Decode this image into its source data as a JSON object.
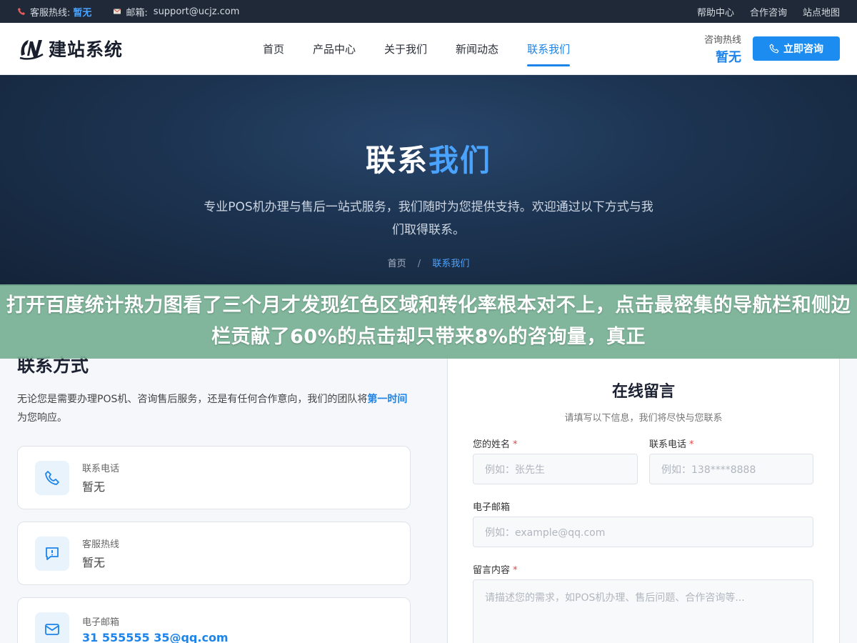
{
  "topbar": {
    "hotline_label": "客服热线:",
    "hotline_value": "暂无",
    "email_label": "邮箱:",
    "email_value": "support@ucjz.com",
    "links": [
      "帮助中心",
      "合作咨询",
      "站点地图"
    ]
  },
  "header": {
    "logo_text": "建站系统",
    "nav": [
      "首页",
      "产品中心",
      "关于我们",
      "新闻动态",
      "联系我们"
    ],
    "active_nav": "联系我们",
    "hotline_label": "咨询热线",
    "hotline_value": "暂无",
    "consult_button": "立即咨询"
  },
  "hero": {
    "title_part1": "联系",
    "title_part2": "我们",
    "subtitle": "专业POS机办理与售后一站式服务，我们随时为您提供支持。欢迎通过以下方式与我们取得联系。",
    "breadcrumb_home": "首页",
    "breadcrumb_sep": "/",
    "breadcrumb_current": "联系我们"
  },
  "banner": {
    "text": "打开百度统计热力图看了三个月才发现红色区域和转化率根本对不上，点击最密集的导航栏和侧边栏贡献了60%的点击却只带来8%的咨询量，真正"
  },
  "contact": {
    "title": "联系方式",
    "desc_prefix": "无论您是需要办理POS机、咨询售后服务，还是有任何合作意向，我们的团队将",
    "desc_emphasis": "第一时间",
    "desc_suffix": "为您响应。",
    "cards": [
      {
        "label": "联系电话",
        "value": "暂无",
        "icon": "phone-icon"
      },
      {
        "label": "客服热线",
        "value": "暂无",
        "icon": "chat-icon"
      },
      {
        "label": "电子邮箱",
        "value": "31 555555 35@qq.com",
        "icon": "mail-icon"
      }
    ]
  },
  "form": {
    "title": "在线留言",
    "subtitle": "请填写以下信息，我们将尽快与您联系",
    "name_label": "您的姓名",
    "name_placeholder": "例如：张先生",
    "phone_label": "联系电话",
    "phone_placeholder": "例如：138****8888",
    "email_label": "电子邮箱",
    "email_placeholder": "例如：example@qq.com",
    "message_label": "留言内容",
    "message_placeholder": "请描述您的需求，如POS机办理、售后问题、合作咨询等...",
    "required_mark": "*"
  },
  "colors": {
    "accent": "#1d84ea",
    "topbar_bg": "#1f2937",
    "hero_bg": "#1c3350",
    "banner_bg": "#76b094"
  }
}
